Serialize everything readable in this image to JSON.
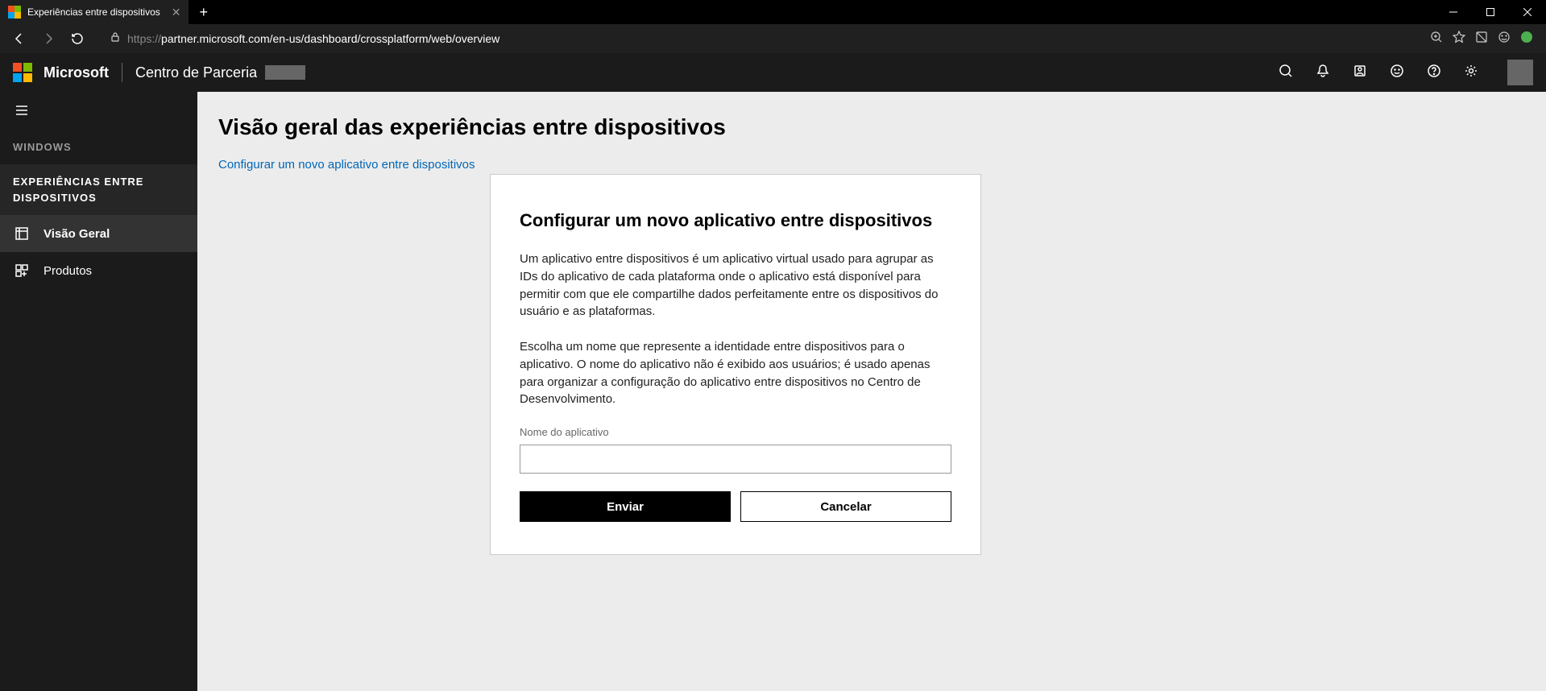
{
  "titlebar": {
    "tab_title": "Experiências entre dispositivos"
  },
  "addressbar": {
    "url_proto": "https://",
    "url_path": "partner.microsoft.com/en-us/dashboard/crossplatform/web/overview"
  },
  "header": {
    "brand": "Microsoft",
    "app_name": "Centro de Parceria"
  },
  "sidebar": {
    "section_label": "WINDOWS",
    "section_title": "EXPERIÊNCIAS ENTRE DISPOSITIVOS",
    "items": [
      {
        "label": "Visão Geral"
      },
      {
        "label": "Produtos"
      }
    ]
  },
  "content": {
    "page_title": "Visão geral das experiências entre dispositivos",
    "configure_link": "Configurar um novo aplicativo entre dispositivos"
  },
  "modal": {
    "title": "Configurar um novo aplicativo entre dispositivos",
    "paragraph1": "Um aplicativo entre dispositivos é um aplicativo virtual usado para agrupar as IDs do aplicativo de cada plataforma onde o aplicativo está disponível para permitir com que ele compartilhe dados perfeitamente entre os dispositivos do usuário e as plataformas.",
    "paragraph2": "Escolha um nome que represente a identidade entre dispositivos para o aplicativo. O nome do aplicativo não é exibido aos usuários; é usado apenas para organizar a configuração do aplicativo entre dispositivos no Centro de Desenvolvimento.",
    "field_label": "Nome do aplicativo",
    "field_value": "",
    "submit_label": "Enviar",
    "cancel_label": "Cancelar"
  }
}
